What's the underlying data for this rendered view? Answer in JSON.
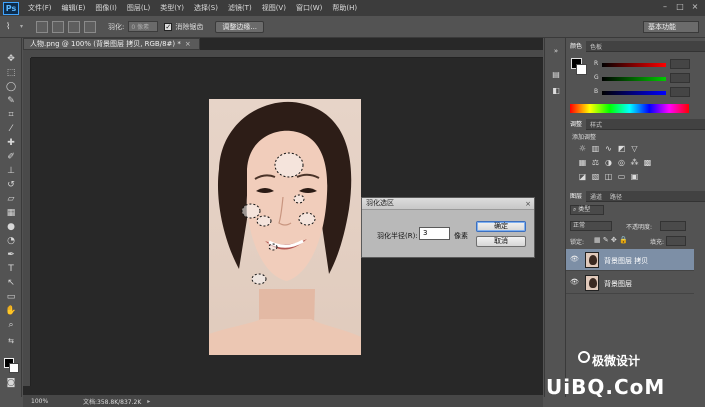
{
  "app": {
    "logo": "Ps"
  },
  "menu": [
    "文件(F)",
    "编辑(E)",
    "图像(I)",
    "图层(L)",
    "类型(Y)",
    "选择(S)",
    "滤镜(T)",
    "视图(V)",
    "窗口(W)",
    "帮助(H)"
  ],
  "options": {
    "feather_label": "羽化:",
    "feather_value": "0 像素",
    "antialias_label": "消除锯齿",
    "refine_button": "调整边缘...",
    "workspace": "基本功能"
  },
  "document": {
    "tab_title": "人物.png @ 100% (背景图层 拷贝, RGB/8#) *",
    "tab_close": "×"
  },
  "status": {
    "zoom": "100%",
    "doc_info": "文档:358.8K/837.2K"
  },
  "dialog": {
    "title": "羽化选区",
    "close": "×",
    "radius_label": "羽化半径(R):",
    "radius_value": "3",
    "unit": "像素",
    "ok": "确定",
    "cancel": "取消"
  },
  "panels": {
    "color_tabs": [
      "颜色",
      "色板"
    ],
    "slider_labels": [
      "R",
      "G",
      "B"
    ],
    "adjust_tabs": [
      "调整",
      "样式"
    ],
    "adjust_add_label": "添加调整",
    "layers_tabs": [
      "图层",
      "通道",
      "路径"
    ],
    "kind_filter": "类型",
    "blend_mode": "正常",
    "opacity_label": "不透明度:",
    "lock_label": "锁定:",
    "fill_label": "填充:",
    "layers": [
      {
        "name": "背景图层 拷贝",
        "selected": true
      },
      {
        "name": "背景图层",
        "selected": false
      }
    ]
  },
  "watermark": {
    "brand": "极微设计",
    "url": "UiBQ.CoM"
  }
}
